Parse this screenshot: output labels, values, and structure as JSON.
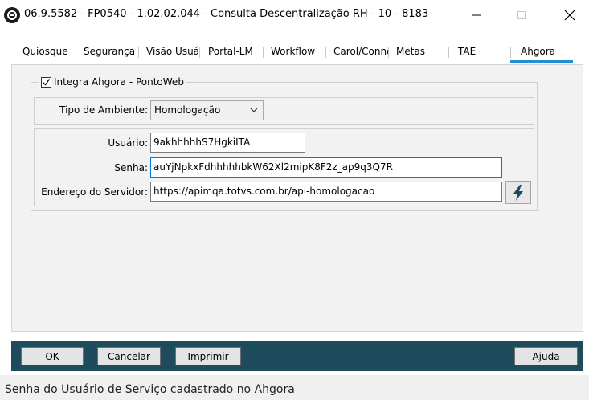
{
  "window": {
    "title": "06.9.5582 - FP0540 - 1.02.02.044 - Consulta Descentralização RH - 10 - 8183"
  },
  "tabs": [
    {
      "label": "Quiosque"
    },
    {
      "label": "Segurança"
    },
    {
      "label": "Visão Usuário"
    },
    {
      "label": "Portal-LM"
    },
    {
      "label": "Workflow"
    },
    {
      "label": "Carol/Connector"
    },
    {
      "label": "Metas"
    },
    {
      "label": "TAE"
    },
    {
      "label": "Ahgora",
      "active": true
    }
  ],
  "group": {
    "checkbox_label": "Integra Ahgora - PontoWeb",
    "checked": true
  },
  "form": {
    "ambiente_label": "Tipo de Ambiente:",
    "ambiente_value": "Homologação",
    "usuario_label": "Usuário:",
    "usuario_value": "9akhhhhhS7HgkiITA",
    "senha_label": "Senha:",
    "senha_value": "auYjNpkxFdhhhhhbkW62Xl2mipK8F2z_ap9q3Q7R",
    "servidor_label": "Endereço do Servidor:",
    "servidor_value": "https://apimqa.totvs.com.br/api-homologacao"
  },
  "footer": {
    "ok": "OK",
    "cancelar": "Cancelar",
    "imprimir": "Imprimir",
    "ajuda": "Ajuda"
  },
  "status": {
    "text": "Senha do Usuário de Serviço cadastrado no Ahgora"
  },
  "colors": {
    "accent": "#1E90D8",
    "footer_bg": "#1E4C5C",
    "focus_border": "#0078d7"
  },
  "icons": {
    "app": "app-logo-icon",
    "test_connection": "lightning-bolt-icon"
  }
}
